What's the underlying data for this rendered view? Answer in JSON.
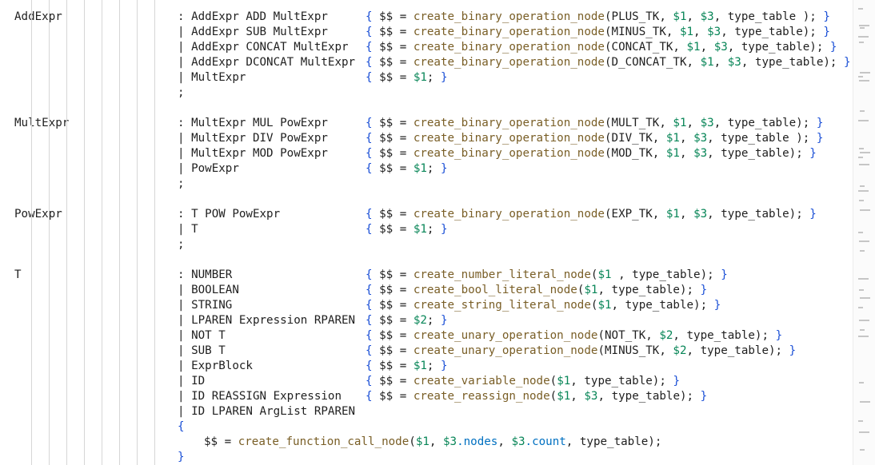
{
  "grammar": {
    "rules": [
      {
        "name": "AddExpr",
        "alternatives": [
          {
            "sep": ":",
            "production": "AddExpr ADD MultExpr",
            "fn": "create_binary_operation_node",
            "args_before": "PLUS_TK, ",
            "num1": "$1",
            "mid": ", ",
            "num2": "$3",
            "args_after": ", type_table );",
            "close": "}"
          },
          {
            "sep": "|",
            "production": "AddExpr SUB MultExpr",
            "fn": "create_binary_operation_node",
            "args_before": "MINUS_TK, ",
            "num1": "$1",
            "mid": ", ",
            "num2": "$3",
            "args_after": ", type_table);",
            "close": "}"
          },
          {
            "sep": "|",
            "production": "AddExpr CONCAT MultExpr",
            "fn": "create_binary_operation_node",
            "args_before": "CONCAT_TK, ",
            "num1": "$1",
            "mid": ", ",
            "num2": "$3",
            "args_after": ", type_table);",
            "close": "}"
          },
          {
            "sep": "|",
            "production": "AddExpr DCONCAT MultExpr",
            "fn": "create_binary_operation_node",
            "args_before": "D_CONCAT_TK, ",
            "num1": "$1",
            "mid": ", ",
            "num2": "$3",
            "args_after": ", type_table);",
            "close": "}"
          },
          {
            "sep": "|",
            "production": "MultExpr",
            "assign": "$1;",
            "close": "}"
          }
        ]
      },
      {
        "name": "MultExpr",
        "alternatives": [
          {
            "sep": ":",
            "production": "MultExpr MUL PowExpr",
            "fn": "create_binary_operation_node",
            "args_before": "MULT_TK, ",
            "num1": "$1",
            "mid": ", ",
            "num2": "$3",
            "args_after": ", type_table);",
            "close": "}"
          },
          {
            "sep": "|",
            "production": "MultExpr DIV PowExpr",
            "fn": "create_binary_operation_node",
            "args_before": "DIV_TK, ",
            "num1": "$1",
            "mid": ", ",
            "num2": "$3",
            "args_after": ", type_table );",
            "close": "}"
          },
          {
            "sep": "|",
            "production": "MultExpr MOD PowExpr",
            "fn": "create_binary_operation_node",
            "args_before": "MOD_TK, ",
            "num1": "$1",
            "mid": ", ",
            "num2": "$3",
            "args_after": ", type_table);",
            "close": "}"
          },
          {
            "sep": "|",
            "production": "PowExpr",
            "assign": "$1;",
            "close": "}"
          }
        ]
      },
      {
        "name": "PowExpr",
        "alternatives": [
          {
            "sep": ":",
            "production": "T POW PowExpr",
            "fn": "create_binary_operation_node",
            "args_before": "EXP_TK, ",
            "num1": "$1",
            "mid": ", ",
            "num2": "$3",
            "args_after": ", type_table);",
            "close": "}"
          },
          {
            "sep": "|",
            "production": "T",
            "assign": "$1;",
            "close": "}"
          }
        ]
      },
      {
        "name": "T",
        "alternatives": [
          {
            "sep": ":",
            "production": "NUMBER",
            "fn": "create_number_literal_node",
            "args_before": "",
            "num1": "$1",
            "args_after": " , type_table);",
            "close": "}"
          },
          {
            "sep": "|",
            "production": "BOOLEAN",
            "fn": "create_bool_literal_node",
            "args_before": "",
            "num1": "$1",
            "args_after": ", type_table);",
            "close": "}"
          },
          {
            "sep": "|",
            "production": "STRING",
            "fn": "create_string_literal_node",
            "args_before": "",
            "num1": "$1",
            "args_after": ", type_table);",
            "close": "}"
          },
          {
            "sep": "|",
            "production": "LPAREN Expression RPAREN",
            "assign": "$2;",
            "close": "}"
          },
          {
            "sep": "|",
            "production": "NOT T",
            "fn": "create_unary_operation_node",
            "args_before": "NOT_TK, ",
            "num1": "$2",
            "args_after": ", type_table);",
            "close": "}"
          },
          {
            "sep": "|",
            "production": "SUB T",
            "fn": "create_unary_operation_node",
            "args_before": "MINUS_TK, ",
            "num1": "$2",
            "args_after": ", type_table);",
            "close": "}"
          },
          {
            "sep": "|",
            "production": "ExprBlock",
            "assign": "$1;",
            "close": "}"
          },
          {
            "sep": "|",
            "production": "ID",
            "fn": "create_variable_node",
            "args_before": "",
            "num1": "$1",
            "args_after": ", type_table);",
            "close": "}"
          },
          {
            "sep": "|",
            "production": "ID REASSIGN Expression",
            "fn": "create_reassign_node",
            "args_before": "",
            "num1": "$1",
            "mid": ", ",
            "num2": "$3",
            "args_after": ", type_table);",
            "close": "}"
          },
          {
            "sep": "|",
            "production": "ID LPAREN ArgList RPAREN",
            "block": {
              "open": "{",
              "lhs": "$$ = ",
              "fn": "create_function_call_node",
              "p1": "$1",
              "p2": ", ",
              "p3": "$3",
              "p4": ".nodes",
              "p5": ", ",
              "p6": "$3",
              "p7": ".count",
              "p8": ", type_table);",
              "close": "}"
            }
          }
        ]
      }
    ],
    "terminator": ";",
    "action_open": "{",
    "action_lhs": "$$ = "
  },
  "colors": {
    "brace": "#1a4fd6",
    "function": "#795e26",
    "numeric": "#098658",
    "field": "#0070c1"
  }
}
